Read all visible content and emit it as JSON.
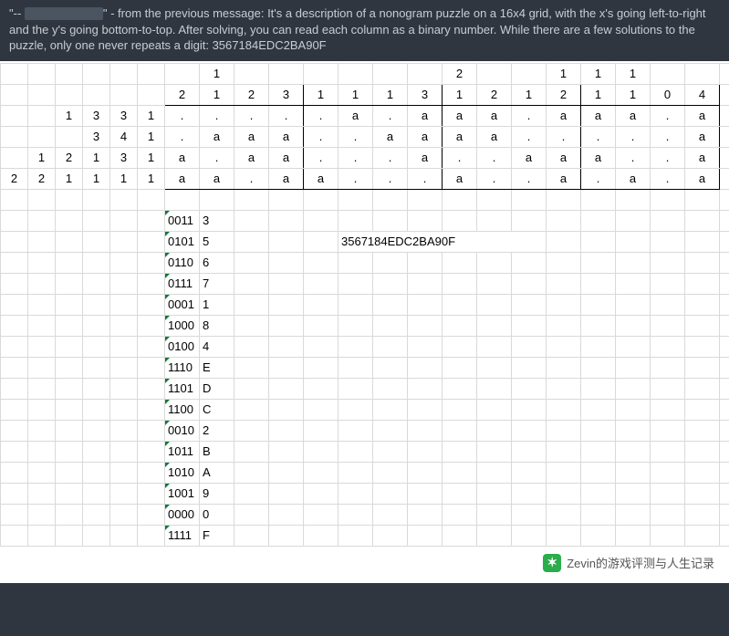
{
  "message": {
    "prefix": "\"-- ",
    "after_redact": "\" - from the previous message: It's a description of a nonogram puzzle on a 16x4 grid, with the x's going left-to-right and the y's going bottom-to-top. After solving, you can read each column as a binary number. While there are a few solutions to the puzzle, only one never repeats a digit: 3567184EDC2BA90F"
  },
  "answer_string": "3567184EDC2BA90F",
  "col_clues_top": [
    "",
    "",
    "",
    "1",
    "",
    "",
    "",
    "",
    "",
    "",
    "2",
    "",
    "",
    "1",
    "1",
    "1",
    "",
    ""
  ],
  "col_clues_bottom": [
    "",
    "",
    "2",
    "1",
    "2",
    "3",
    "1",
    "1",
    "1",
    "3",
    "1",
    "2",
    "1",
    "2",
    "1",
    "1",
    "0",
    "4"
  ],
  "row_clues": [
    [
      "",
      "",
      "1",
      "3",
      "3",
      "1"
    ],
    [
      "",
      "",
      "",
      "3",
      "4",
      "1"
    ],
    [
      "",
      "1",
      "2",
      "1",
      "3",
      "1"
    ],
    [
      "2",
      "2",
      "1",
      "1",
      "1",
      "1"
    ]
  ],
  "grid": [
    [
      ".",
      ".",
      ".",
      ".",
      ".",
      "a",
      ".",
      "a",
      "a",
      "a",
      ".",
      "a",
      "a",
      "a",
      ".",
      "a"
    ],
    [
      ".",
      "a",
      "a",
      "a",
      ".",
      ".",
      "a",
      "a",
      "a",
      "a",
      ".",
      ".",
      ".",
      ".",
      ".",
      "a"
    ],
    [
      "a",
      ".",
      "a",
      "a",
      ".",
      ".",
      ".",
      "a",
      ".",
      ".",
      "a",
      "a",
      "a",
      ".",
      ".",
      "a"
    ],
    [
      "a",
      "a",
      ".",
      "a",
      "a",
      ".",
      ".",
      ".",
      "a",
      ".",
      ".",
      "a",
      ".",
      "a",
      ".",
      "a"
    ]
  ],
  "binary_table": [
    {
      "bin": "0011",
      "hex": "3"
    },
    {
      "bin": "0101",
      "hex": "5"
    },
    {
      "bin": "0110",
      "hex": "6"
    },
    {
      "bin": "0111",
      "hex": "7"
    },
    {
      "bin": "0001",
      "hex": "1"
    },
    {
      "bin": "1000",
      "hex": "8"
    },
    {
      "bin": "0100",
      "hex": "4"
    },
    {
      "bin": "1110",
      "hex": "E"
    },
    {
      "bin": "1101",
      "hex": "D"
    },
    {
      "bin": "1100",
      "hex": "C"
    },
    {
      "bin": "0010",
      "hex": "2"
    },
    {
      "bin": "1011",
      "hex": "B"
    },
    {
      "bin": "1010",
      "hex": "A"
    },
    {
      "bin": "1001",
      "hex": "9"
    },
    {
      "bin": "0000",
      "hex": "0"
    },
    {
      "bin": "1111",
      "hex": "F"
    }
  ],
  "watermark": "Zevin的游戏评测与人生记录"
}
